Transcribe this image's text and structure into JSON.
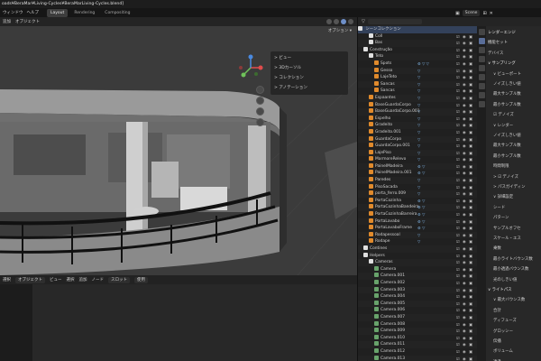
{
  "window": {
    "title": "oads¥BeraMar¥Living-Cycles¥BeraMarLiving-Cycles.blend]"
  },
  "menubar": [
    "ウィンドウ",
    "ヘルプ"
  ],
  "workspace_tabs": [
    {
      "label": "Layout",
      "active": true
    },
    {
      "label": "Rendering",
      "active": false
    },
    {
      "label": "Compositing",
      "active": false
    }
  ],
  "scene": {
    "name": "Scene"
  },
  "viewport": {
    "header_items": [
      "追加",
      "オブジェクト"
    ],
    "options_label": "オプション ▾",
    "npanel_items": [
      "> ビュー",
      "> 3Dカーソル",
      "> コレクション",
      "> アノテーション"
    ]
  },
  "lower_editor": {
    "header_items": [
      "選択",
      "オブジェクト",
      "ビュー",
      "選択",
      "追加",
      "ノード",
      "スロット",
      "使用"
    ]
  },
  "outliner": {
    "title": "シーンコレクション",
    "rows": [
      {
        "name": "Coll",
        "indent": 1,
        "icon": "coll"
      },
      {
        "name": "Bas",
        "indent": 1,
        "icon": "coll"
      },
      {
        "name": "Construção",
        "indent": 0,
        "icon": "coll"
      },
      {
        "name": "Teto",
        "indent": 1,
        "icon": "coll"
      },
      {
        "name": "Spots",
        "indent": 2,
        "icon": "mesh",
        "mods": "⚙ ▽ ▽"
      },
      {
        "name": "Gesso",
        "indent": 2,
        "icon": "mesh",
        "mods": "▽"
      },
      {
        "name": "LajeTeto",
        "indent": 2,
        "icon": "mesh",
        "mods": "▽"
      },
      {
        "name": "Sancas",
        "indent": 2,
        "icon": "mesh",
        "mods": "▽"
      },
      {
        "name": "Sancas",
        "indent": 2,
        "icon": "mesh",
        "mods": "▽"
      },
      {
        "name": "Espaantes",
        "indent": 1,
        "icon": "mesh",
        "mods": "▽"
      },
      {
        "name": "BaseGuardaCorpo",
        "indent": 1,
        "icon": "mesh",
        "mods": "▽"
      },
      {
        "name": "BaseGuardaCorpo.001",
        "indent": 1,
        "icon": "mesh",
        "mods": "▽"
      },
      {
        "name": "Espelho",
        "indent": 1,
        "icon": "mesh",
        "mods": "▽"
      },
      {
        "name": "Gradeito",
        "indent": 1,
        "icon": "mesh",
        "mods": "▽"
      },
      {
        "name": "Gradeito.001",
        "indent": 1,
        "icon": "mesh",
        "mods": "▽"
      },
      {
        "name": "GuardaCorpo",
        "indent": 1,
        "icon": "mesh",
        "mods": "▽"
      },
      {
        "name": "GuardaCorpo.001",
        "indent": 1,
        "icon": "mesh",
        "mods": "▽"
      },
      {
        "name": "LajePiso",
        "indent": 1,
        "icon": "mesh",
        "mods": "▽"
      },
      {
        "name": "MarmoreRelevo",
        "indent": 1,
        "icon": "mesh",
        "mods": "▽"
      },
      {
        "name": "PainelMadeira",
        "indent": 1,
        "icon": "mesh",
        "mods": "⚙ ▽"
      },
      {
        "name": "PainelMadeira.001",
        "indent": 1,
        "icon": "mesh",
        "mods": "⚙ ▽"
      },
      {
        "name": "Paredes",
        "indent": 1,
        "icon": "mesh",
        "mods": "▽"
      },
      {
        "name": "PisoSacada",
        "indent": 1,
        "icon": "mesh",
        "mods": "▽"
      },
      {
        "name": "porta_ferro.009",
        "indent": 1,
        "icon": "mesh",
        "mods": "▽"
      },
      {
        "name": "PortaCozinha",
        "indent": 1,
        "icon": "mesh",
        "mods": "⚙ ▽"
      },
      {
        "name": "PortaCozinhaBandeira",
        "indent": 1,
        "icon": "mesh",
        "mods": "⚙ ▽"
      },
      {
        "name": "PortaCozinhaBarreira",
        "indent": 1,
        "icon": "mesh",
        "mods": "⚙ ▽"
      },
      {
        "name": "PortaLavabo",
        "indent": 1,
        "icon": "mesh",
        "mods": "⚙ ▽"
      },
      {
        "name": "PortaLavaboFrame",
        "indent": 1,
        "icon": "mesh",
        "mods": "⚙ ▽"
      },
      {
        "name": "Rodapessoal",
        "indent": 1,
        "icon": "mesh",
        "mods": "▽"
      },
      {
        "name": "Rodape",
        "indent": 1,
        "icon": "mesh",
        "mods": "▽"
      },
      {
        "name": "Contines",
        "indent": 0,
        "icon": "coll"
      },
      {
        "name": "Helpers",
        "indent": 0,
        "icon": "coll"
      },
      {
        "name": "Cameras",
        "indent": 1,
        "icon": "coll"
      },
      {
        "name": "Camera",
        "indent": 2,
        "icon": "cam"
      },
      {
        "name": "Camera.001",
        "indent": 2,
        "icon": "cam"
      },
      {
        "name": "Camera.002",
        "indent": 2,
        "icon": "cam"
      },
      {
        "name": "Camera.003",
        "indent": 2,
        "icon": "cam"
      },
      {
        "name": "Camera.004",
        "indent": 2,
        "icon": "cam"
      },
      {
        "name": "Camera.005",
        "indent": 2,
        "icon": "cam"
      },
      {
        "name": "Camera.006",
        "indent": 2,
        "icon": "cam"
      },
      {
        "name": "Camera.007",
        "indent": 2,
        "icon": "cam"
      },
      {
        "name": "Camera.008",
        "indent": 2,
        "icon": "cam"
      },
      {
        "name": "Camera.009",
        "indent": 2,
        "icon": "cam"
      },
      {
        "name": "Camera.010",
        "indent": 2,
        "icon": "cam"
      },
      {
        "name": "Camera.011",
        "indent": 2,
        "icon": "cam"
      },
      {
        "name": "Camera.012",
        "indent": 2,
        "icon": "cam"
      },
      {
        "name": "Camera.013",
        "indent": 2,
        "icon": "cam"
      }
    ]
  },
  "properties": {
    "rows": [
      {
        "text": "レンダーエンジ",
        "sec": true
      },
      {
        "text": "機能セット"
      },
      {
        "text": "デバイス"
      },
      {
        "text": "∨ サンプリング",
        "sec": true
      },
      {
        "text": "∨ ビューポート",
        "sub": true
      },
      {
        "text": "ノイズしきい値",
        "sub": true
      },
      {
        "text": "最大サンプル数",
        "sub": true
      },
      {
        "text": "最小サンプル数",
        "sub": true
      },
      {
        "text": "☑ デノイズ",
        "sub": true
      },
      {
        "text": "∨ レンダー",
        "sub": true
      },
      {
        "text": "ノイズしきい値",
        "sub": true
      },
      {
        "text": "最大サンプル数",
        "sub": true
      },
      {
        "text": "最小サンプル数",
        "sub": true
      },
      {
        "text": "時間制限",
        "sub": true
      },
      {
        "text": "> ☑ デノイズ",
        "sub": true
      },
      {
        "text": "> パスガイディン",
        "sub": true
      },
      {
        "text": "∨ 詳細設定",
        "sub": true
      },
      {
        "text": "シード",
        "sub": true
      },
      {
        "text": "パターン",
        "sub": true
      },
      {
        "text": "サンプルオフセ",
        "sub": true
      },
      {
        "text": "スケール・エス",
        "sub": true
      },
      {
        "text": "乗数",
        "sub": true
      },
      {
        "text": "最小ライトバウンス数",
        "sub": true
      },
      {
        "text": "最小透過バウンス数",
        "sub": true
      },
      {
        "text": "光のしきい値",
        "sub": true
      },
      {
        "text": "∨ ライトパス",
        "sec": true
      },
      {
        "text": "∨ 最大バウンス数",
        "sub": true
      },
      {
        "text": "合計",
        "sub": true
      },
      {
        "text": "ディフューズ",
        "sub": true
      },
      {
        "text": "グロッシー",
        "sub": true
      },
      {
        "text": "伝播",
        "sub": true
      },
      {
        "text": "ボリューム",
        "sub": true
      },
      {
        "text": "透過",
        "sub": true
      }
    ]
  },
  "colors": {
    "accent": "#5a6e99",
    "mesh": "#e08a2c",
    "camera": "#68a36b",
    "selected_row": "#33415a"
  }
}
